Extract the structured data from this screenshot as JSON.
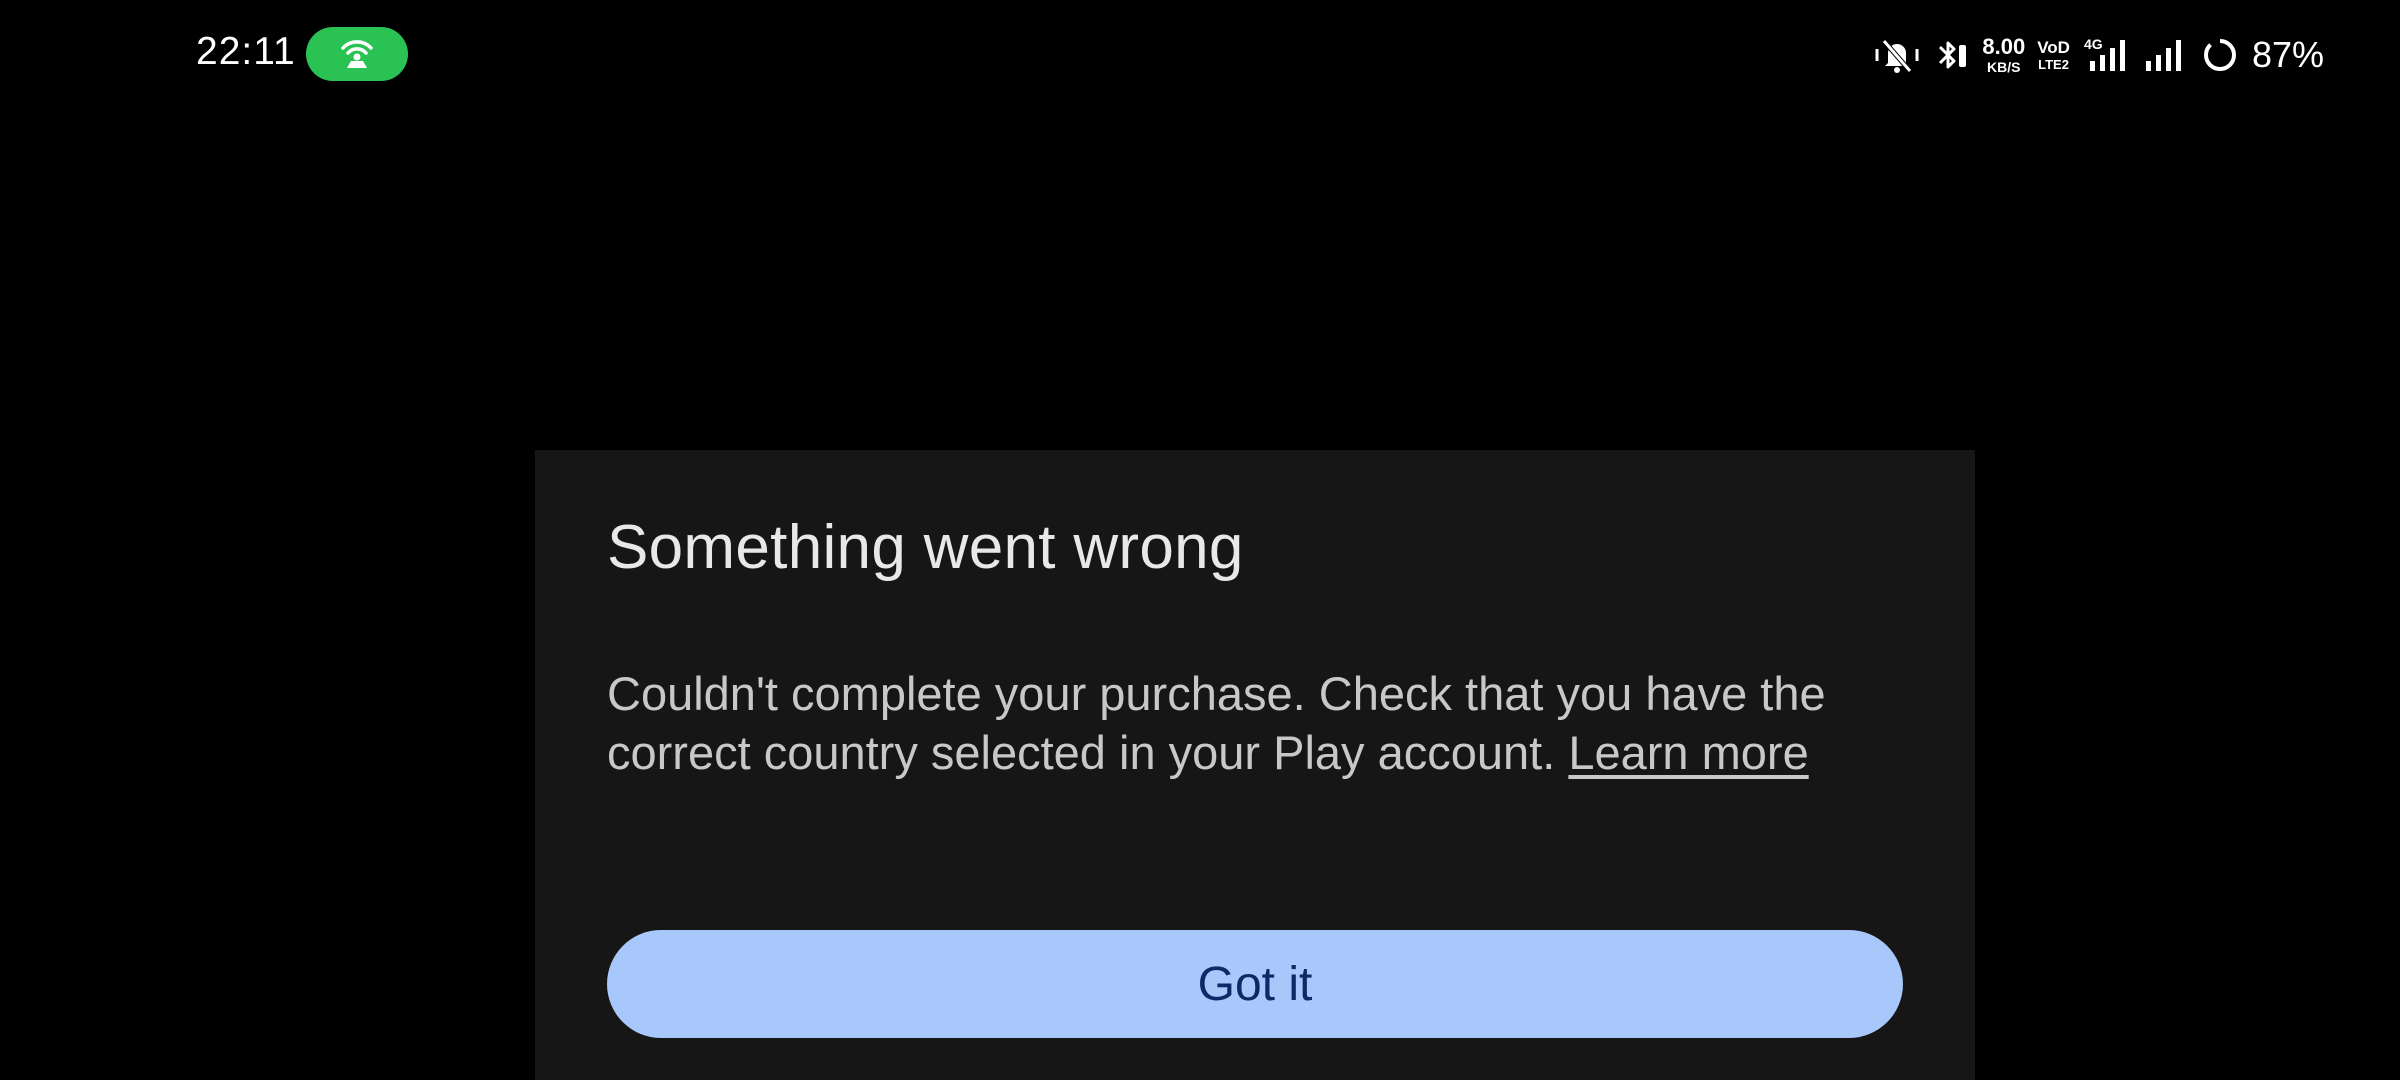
{
  "status_bar": {
    "time": "22:11",
    "hotspot_icon": "hotspot-icon",
    "hotspot_color": "#2ac353",
    "net_speed_value": "8.00",
    "net_speed_unit": "KB/S",
    "volte_top": "VoD",
    "volte_bottom": "LTE2",
    "network_type": "4G",
    "battery_percent": "87%",
    "icons": [
      "vibrate-icon",
      "bluetooth-icon",
      "signal-icon",
      "signal-icon",
      "battery-icon"
    ]
  },
  "dialog": {
    "title": "Something went wrong",
    "message": "Couldn't complete your purchase. Check that you have the correct country selected in your Play account.",
    "link_label": "Learn more",
    "button_label": "Got it",
    "button_color": "#a8c7fa",
    "surface_color": "#161616"
  }
}
